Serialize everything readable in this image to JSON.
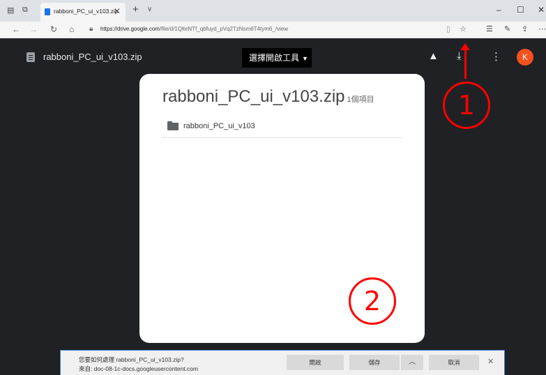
{
  "browser": {
    "tab_title": "rabboni_PC_ui_v103.zip",
    "tab_close": "✕",
    "new_tab": "+",
    "tab_menu": "∨",
    "url_host": "https://drive.google.com",
    "url_path": "/file/d/1QlteNTf_qbfuyd_pVq2TzNsm6T4tym6_/view",
    "window_minimize": "–",
    "window_maximize": "☐",
    "window_close": "✕"
  },
  "viewer": {
    "file_name": "rabboni_PC_ui_v103.zip",
    "open_with_label": "選擇開啟工具",
    "avatar_letter": "K"
  },
  "card": {
    "title": "rabboni_PC_ui_v103.zip",
    "count": "1個項目",
    "items": [
      {
        "label": "rabboni_PC_ui_v103"
      }
    ]
  },
  "annotations": {
    "marker1": "1",
    "marker2": "2"
  },
  "download_prompt": {
    "question": "您要如何處理 rabboni_PC_ui_v103.zip?",
    "source": "來自: doc-08-1c-docs.googleusercontent.com",
    "open_label": "開啟",
    "save_label": "儲存",
    "save_menu": "︿",
    "cancel_label": "取消",
    "close": "✕"
  },
  "colors": {
    "annotation_red": "#ff0000",
    "avatar": "#f4511e",
    "viewer_background": "#202124"
  },
  "icons": [
    "tab-actions-icon",
    "tabs-aside-icon",
    "drive-add-icon",
    "download-icon",
    "more-vert-icon",
    "folder-icon",
    "file-icon",
    "star-icon",
    "favorites-icon",
    "pen-icon",
    "share-icon"
  ]
}
